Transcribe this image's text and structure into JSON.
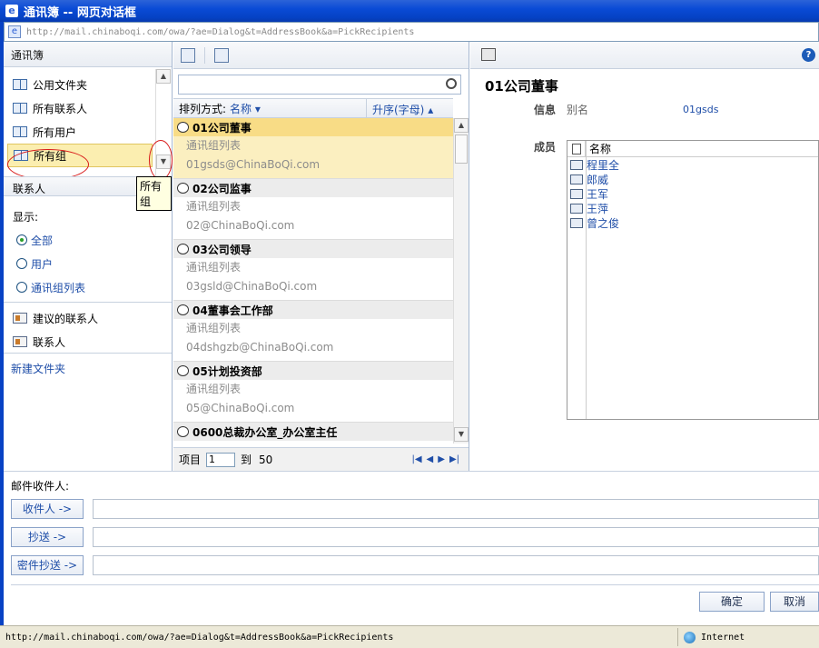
{
  "window": {
    "title": "通讯簿 -- 网页对话框",
    "address": "http://mail.chinaboqi.com/owa/?ae=Dialog&t=AddressBook&a=PickRecipients"
  },
  "left": {
    "header": "通讯簿",
    "folders": [
      {
        "label": "公用文件夹"
      },
      {
        "label": "所有联系人"
      },
      {
        "label": "所有用户"
      },
      {
        "label": "所有组"
      }
    ],
    "tooltip": "所有组",
    "contacts_header": "联系人",
    "show_label": "显示:",
    "show_options": [
      {
        "label": "全部",
        "selected": true
      },
      {
        "label": "用户",
        "selected": false
      },
      {
        "label": "通讯组列表",
        "selected": false
      }
    ],
    "contact_folders": [
      {
        "label": "建议的联系人"
      },
      {
        "label": "联系人"
      }
    ],
    "new_folder": "新建文件夹"
  },
  "middle": {
    "sort_label": "排列方式:",
    "sort_field": "名称",
    "sort_order": "升序(字母)",
    "groups": [
      {
        "name": "01公司董事",
        "type": "通讯组列表",
        "email": "01gsds@ChinaBoQi.com",
        "selected": true
      },
      {
        "name": "02公司监事",
        "type": "通讯组列表",
        "email": "02@ChinaBoQi.com",
        "selected": false
      },
      {
        "name": "03公司领导",
        "type": "通讯组列表",
        "email": "03gsld@ChinaBoQi.com",
        "selected": false
      },
      {
        "name": "04董事会工作部",
        "type": "通讯组列表",
        "email": "04dshgzb@ChinaBoQi.com",
        "selected": false
      },
      {
        "name": "05计划投资部",
        "type": "通讯组列表",
        "email": "05@ChinaBoQi.com",
        "selected": false
      },
      {
        "name": "0600总裁办公室_办公室主任",
        "type": "",
        "email": "",
        "selected": false
      }
    ],
    "pager": {
      "label_item": "项目",
      "current": "1",
      "label_to": "到",
      "total": "50"
    }
  },
  "right": {
    "title": "01公司董事",
    "info_label": "信息",
    "alias_key": "别名",
    "alias_value": "01gsds",
    "members_label": "成员",
    "members_col": "名称",
    "members": [
      "程里全",
      "郎威",
      "王军",
      "王萍",
      "曾之俊"
    ]
  },
  "recipients": {
    "title": "邮件收件人:",
    "to_btn": "收件人 ->",
    "cc_btn": "抄送 ->",
    "bcc_btn": "密件抄送 ->",
    "ok": "确定",
    "cancel": "取消"
  },
  "status": {
    "url": "http://mail.chinaboqi.com/owa/?ae=Dialog&t=AddressBook&a=PickRecipients",
    "zone": "Internet"
  }
}
